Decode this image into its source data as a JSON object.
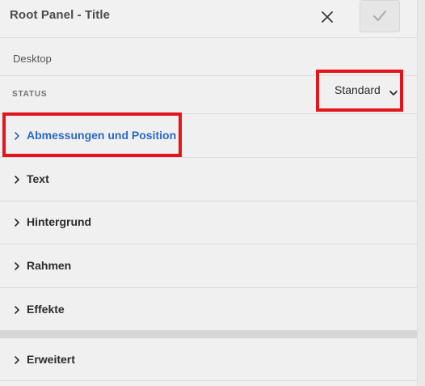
{
  "header": {
    "title": "Root Panel - Title",
    "close_icon": "close-icon",
    "confirm_icon": "checkmark-icon"
  },
  "device": {
    "label": "Desktop"
  },
  "status": {
    "label": "STATUS",
    "selected_value": "Standard",
    "dropdown_icon": "chevron-down-icon"
  },
  "accordion": {
    "items": [
      {
        "label": "Abmessungen und Position",
        "icon": "chevron-right-icon",
        "active": true
      },
      {
        "label": "Text",
        "icon": "chevron-right-icon"
      },
      {
        "label": "Hintergrund",
        "icon": "chevron-right-icon"
      },
      {
        "label": "Rahmen",
        "icon": "chevron-right-icon"
      },
      {
        "label": "Effekte",
        "icon": "chevron-right-icon"
      },
      {
        "label": "Erweitert",
        "icon": "chevron-right-icon"
      }
    ]
  },
  "colors": {
    "highlight": "#e3151a",
    "active_label": "#2a68c4"
  }
}
